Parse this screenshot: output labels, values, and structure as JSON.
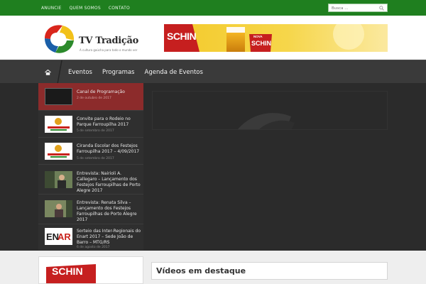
{
  "topbar": {
    "links": [
      "ANUNCIE",
      "QUEM SOMOS",
      "CONTATO"
    ],
    "search_placeholder": "Busca ..."
  },
  "brand": {
    "title": "TV Tradição",
    "tagline": "A cultura gaúcha para todo o mundo ver"
  },
  "banner": {
    "brand": "SCHIN",
    "label": "NOVA"
  },
  "nav": {
    "items": [
      "Eventos",
      "Programas",
      "Agenda de Eventos"
    ]
  },
  "videos": [
    {
      "title": "Canal de Programação",
      "date": "2 de outubro de 2017",
      "active": true
    },
    {
      "title": "Convite para o Rodeio no Parque Farroupilha 2017",
      "date": "5 de setembro de 2017"
    },
    {
      "title": "Ciranda Escolar dos Festejos Farroupilha 2017 – 4/09/2017",
      "date": "5 de setembro de 2017"
    },
    {
      "title": "Entrevista: Nairioli A. Callegaro – Lançamento dos Festejos Farroupilhas de Porto Alegre 2017",
      "date": ""
    },
    {
      "title": "Entrevista: Renata Silva – Lançamento dos Festejos Farroupilhas de Porto Alegre 2017",
      "date": ""
    },
    {
      "title": "Sorteio das Inter-Regionais do Enart 2017 – Sede João de Barro – MTG/RS",
      "date": "6 de agosto de 2017"
    }
  ],
  "featured": {
    "heading": "Vídeos em destaque"
  },
  "ad2": {
    "brand": "SCHIN"
  },
  "colors": {
    "topbar": "#1f7f1f",
    "active_item": "#8c2b2b",
    "nav": "#3a3a3a"
  }
}
